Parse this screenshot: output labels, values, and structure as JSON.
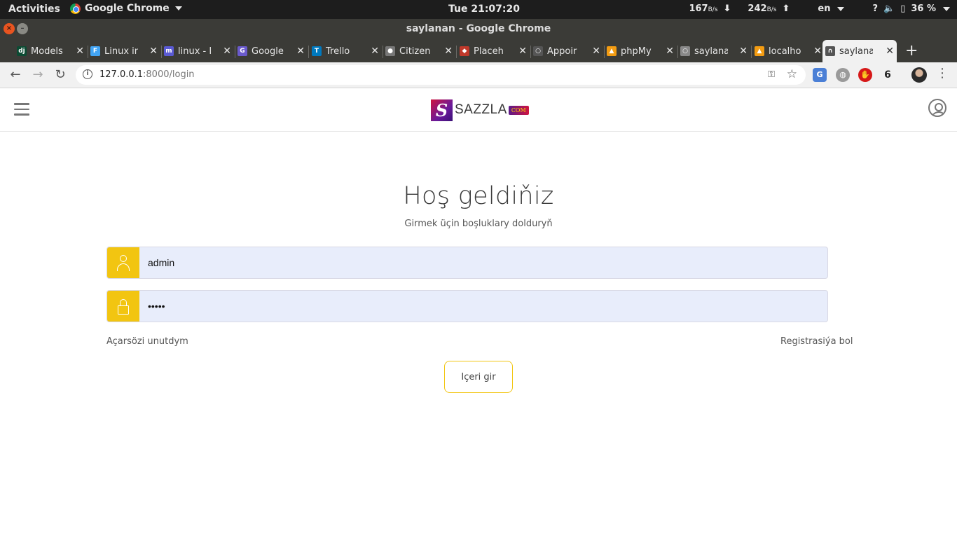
{
  "system_bar": {
    "activities": "Activities",
    "app_name": "Google Chrome",
    "clock": "Tue 21:07:20",
    "net_down": "167",
    "net_down_unit": "B/s",
    "net_up": "242",
    "net_up_unit": "B/s",
    "language": "en",
    "help": "?",
    "battery": "36 %"
  },
  "window": {
    "title": "saylanan - Google Chrome"
  },
  "tabs": [
    {
      "label": "Models",
      "icon": "django-icon",
      "color": "#0c4b33",
      "glyph": "dj"
    },
    {
      "label": "Linux in",
      "icon": "flutter-icon",
      "color": "#42a5f5",
      "glyph": "F"
    },
    {
      "label": "linux - I",
      "icon": "mastodon-icon",
      "color": "#5a5ad4",
      "glyph": "m"
    },
    {
      "label": "Google",
      "icon": "google-icon",
      "color": "#6a5acd",
      "glyph": "G"
    },
    {
      "label": "Trello",
      "icon": "trello-icon",
      "color": "#0079bf",
      "glyph": "T"
    },
    {
      "label": "Citizen",
      "icon": "drop-icon",
      "color": "#777777",
      "glyph": "●"
    },
    {
      "label": "Placeh",
      "icon": "layers-icon",
      "color": "#c0392b",
      "glyph": "◆"
    },
    {
      "label": "Appoir",
      "icon": "globe-icon",
      "color": "#555555",
      "glyph": "○"
    },
    {
      "label": "phpMy",
      "icon": "phpmyadmin-icon",
      "color": "#f39c12",
      "glyph": "▲"
    },
    {
      "label": "saylana",
      "icon": "globe-icon",
      "color": "#888888",
      "glyph": "○"
    },
    {
      "label": "localho",
      "icon": "phpmyadmin-icon",
      "color": "#f39c12",
      "glyph": "▲"
    },
    {
      "label": "saylana",
      "icon": "headphones-icon",
      "color": "#555555",
      "glyph": "∩",
      "active": true
    }
  ],
  "toolbar": {
    "url_host": "127.0.0.1",
    "url_rest": ":8000/login",
    "extension_badge": "6"
  },
  "header": {
    "logo_mark": "S",
    "logo_word": "SAZZLA",
    "logo_suffix": "COM"
  },
  "login": {
    "title": "Hoş geldiňiz",
    "subtitle": "Girmek üçin boşluklary dolduryň",
    "username_value": "admin",
    "password_value": "•••••",
    "forgot_link": "Açarsözi unutdym",
    "register_link": "Registrasiýa bol",
    "submit_label": "Içeri gir"
  },
  "colors": {
    "accent_yellow": "#f2c511",
    "input_fill": "#e8edfb",
    "brand_red": "#d0153f",
    "brand_purple": "#3b1277"
  }
}
